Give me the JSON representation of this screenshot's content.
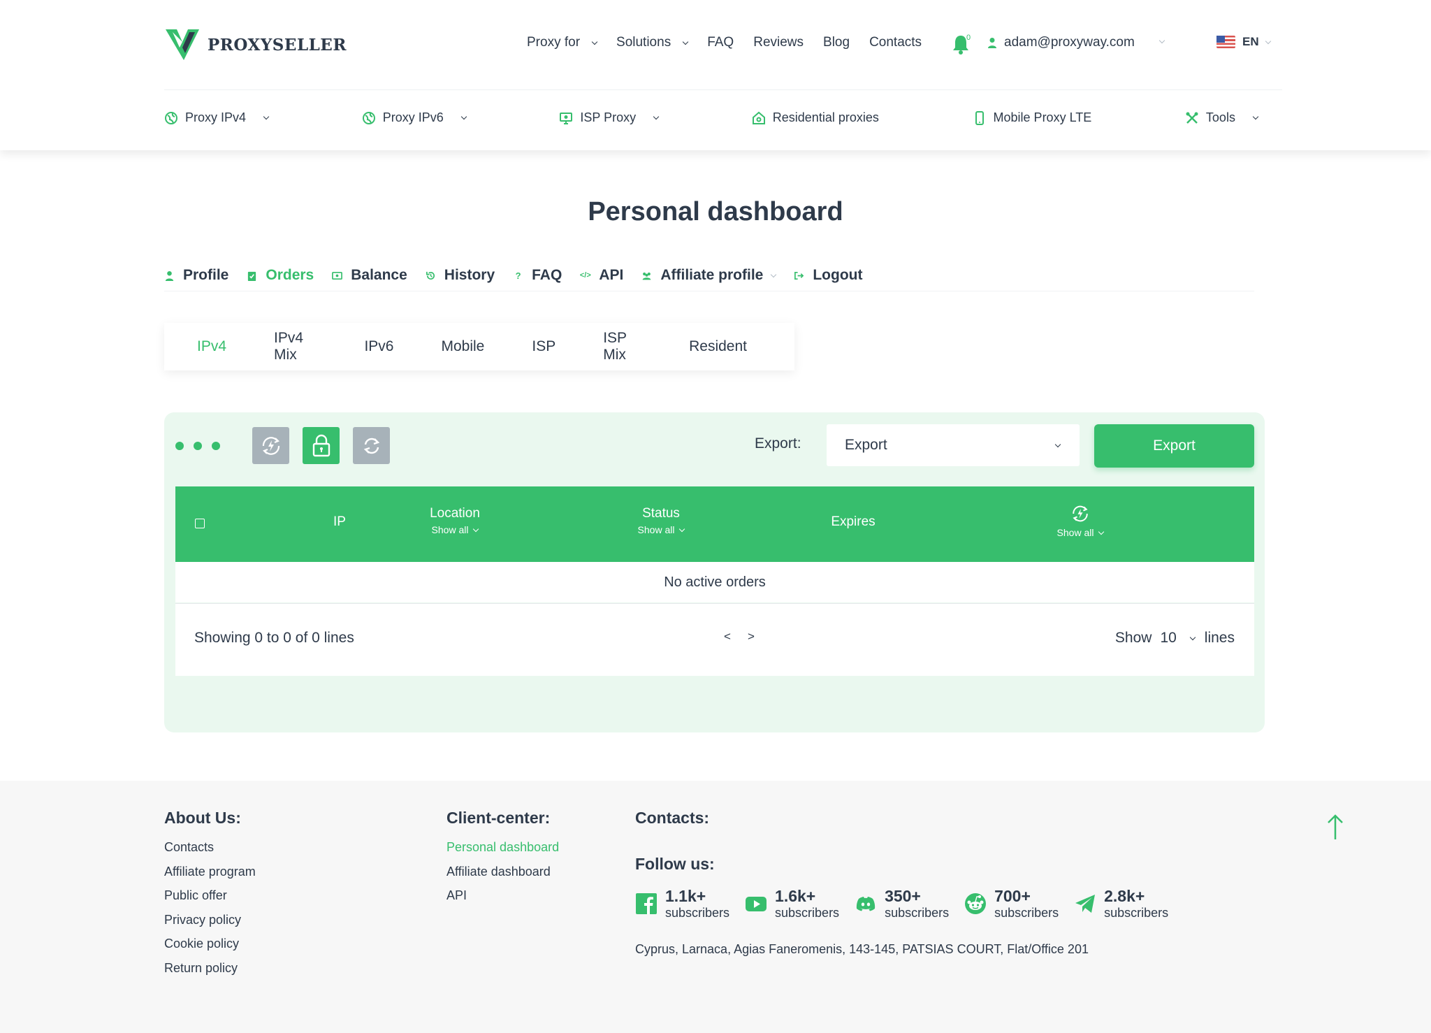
{
  "brand": {
    "name": "PROXYSELLER"
  },
  "topnav": {
    "items": [
      {
        "label": "Proxy for",
        "dropdown": true
      },
      {
        "label": "Solutions",
        "dropdown": true
      },
      {
        "label": "FAQ",
        "dropdown": false
      },
      {
        "label": "Reviews",
        "dropdown": false
      },
      {
        "label": "Blog",
        "dropdown": false
      },
      {
        "label": "Contacts",
        "dropdown": false
      }
    ],
    "notifications_count": "0",
    "user_email": "adam@proxyway.com",
    "language": "EN"
  },
  "prodnav": {
    "items": [
      {
        "label": "Proxy IPv4",
        "icon": "globe-icon",
        "dropdown": true
      },
      {
        "label": "Proxy IPv6",
        "icon": "globe-icon",
        "dropdown": true
      },
      {
        "label": "ISP Proxy",
        "icon": "monitor-icon",
        "dropdown": true
      },
      {
        "label": "Residential proxies",
        "icon": "home-icon",
        "dropdown": false
      },
      {
        "label": "Mobile Proxy LTE",
        "icon": "phone-icon",
        "dropdown": false
      },
      {
        "label": "Tools",
        "icon": "tools-icon",
        "dropdown": true
      }
    ]
  },
  "page": {
    "title": "Personal dashboard"
  },
  "dashtabs": [
    {
      "label": "Profile",
      "icon": "user-icon",
      "active": false
    },
    {
      "label": "Orders",
      "icon": "clipboard-icon",
      "active": true
    },
    {
      "label": "Balance",
      "icon": "wallet-icon",
      "active": false
    },
    {
      "label": "History",
      "icon": "history-icon",
      "active": false
    },
    {
      "label": "FAQ",
      "icon": "question-icon",
      "active": false
    },
    {
      "label": "API",
      "icon": "code-icon",
      "active": false
    },
    {
      "label": "Affiliate profile",
      "icon": "users-icon",
      "active": false,
      "dropdown": true
    },
    {
      "label": "Logout",
      "icon": "logout-icon",
      "active": false
    }
  ],
  "protabs": [
    {
      "label": "IPv4",
      "active": true
    },
    {
      "label": "IPv4 Mix",
      "active": false
    },
    {
      "label": "IPv6",
      "active": false
    },
    {
      "label": "Mobile",
      "active": false
    },
    {
      "label": "ISP",
      "active": false
    },
    {
      "label": "ISP Mix",
      "active": false
    },
    {
      "label": "Resident",
      "active": false
    }
  ],
  "toolbar": {
    "export_label": "Export:",
    "export_select_value": "Export",
    "export_button": "Export"
  },
  "table": {
    "columns": {
      "ip": "IP",
      "location": "Location",
      "location_filter": "Show all",
      "status": "Status",
      "status_filter": "Show all",
      "expires": "Expires",
      "autorenew_filter": "Show all"
    },
    "empty_message": "No active orders",
    "showing": "Showing 0 to 0 of 0 lines",
    "prev": "<",
    "next": ">",
    "show_label": "Show",
    "show_value": "10",
    "lines_label": "lines"
  },
  "footer": {
    "about": {
      "title": "About Us:",
      "links": [
        "Contacts",
        "Affiliate program",
        "Public offer",
        "Privacy policy",
        "Cookie policy",
        "Return policy"
      ]
    },
    "client": {
      "title": "Client-center:",
      "links": [
        "Personal dashboard",
        "Affiliate dashboard",
        "API"
      ]
    },
    "contacts": {
      "title": "Contacts:"
    },
    "follow": {
      "title": "Follow us:",
      "items": [
        {
          "network": "facebook-icon",
          "count": "1.1k+",
          "label": "subscribers"
        },
        {
          "network": "youtube-icon",
          "count": "1.6k+",
          "label": "subscribers"
        },
        {
          "network": "discord-icon",
          "count": "350+",
          "label": "subscribers"
        },
        {
          "network": "reddit-icon",
          "count": "700+",
          "label": "subscribers"
        },
        {
          "network": "telegram-icon",
          "count": "2.8k+",
          "label": "subscribers"
        }
      ]
    },
    "address": "Cyprus, Larnaca, Agias Faneromenis, 143-145, PATSIAS COURT, Flat/Office 201"
  },
  "colors": {
    "accent": "#37be6d",
    "text": "#2e3a4a",
    "panel": "#eaf8ef",
    "footer_bg": "#f7f7f7"
  }
}
